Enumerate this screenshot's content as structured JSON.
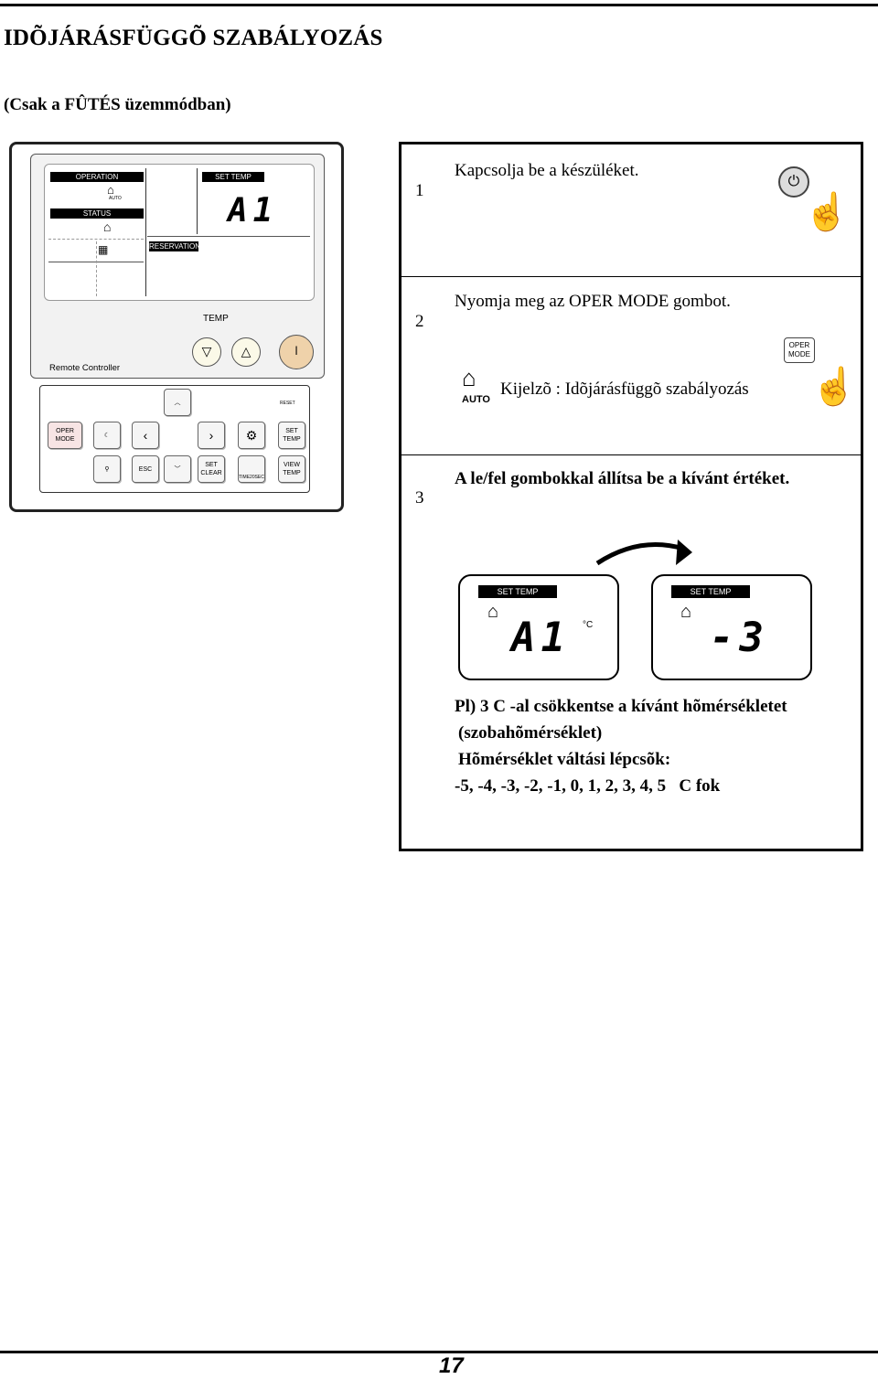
{
  "header": {
    "title": "IDÕJÁRÁSFÜGGÕ SZABÁLYOZÁS",
    "subtitle": "(Csak a FÛTÉS üzemmódban)"
  },
  "remote": {
    "lcd": {
      "operation": "OPERATION",
      "auto": "AUTO",
      "status": "STATUS",
      "set_temp": "SET TEMP",
      "value": "A1",
      "reservation": "RESERVATION"
    },
    "temp_label": "TEMP",
    "brand_label": "Remote Controller",
    "reset_label": "RESET",
    "keys": {
      "oper_mode": "OPER MODE",
      "esc": "ESC",
      "set_clear": "SET CLEAR",
      "time": "TIME20SEC",
      "set_temp": "SET TEMP",
      "view_temp": "VIEW TEMP"
    }
  },
  "steps": [
    {
      "number": "1",
      "text": "Kapcsolja be a készüléket."
    },
    {
      "number": "2",
      "text": "Nyomja meg az OPER MODE gombot.",
      "button_label": "OPER MODE",
      "icon_label": "AUTO",
      "display_text": "Kijelzõ : Idõjárásfüggõ szabályozás"
    },
    {
      "number": "3",
      "text": "A le/fel gombokkal állítsa be a kívánt értéket.",
      "display_before": {
        "label": "SET TEMP",
        "value": "A1",
        "unit": "°C"
      },
      "display_after": {
        "label": "SET TEMP",
        "value": "-3"
      },
      "notes": [
        "Pl)  3 C -al csökkentse a kívánt hõmérsékletet",
        "(szobahõmérséklet)",
        "Hõmérséklet váltási lépcsõk:",
        "-5, -4, -3, -2, -1, 0, 1, 2, 3, 4, 5   C fok"
      ]
    }
  ],
  "footer": {
    "page_number": "17"
  }
}
